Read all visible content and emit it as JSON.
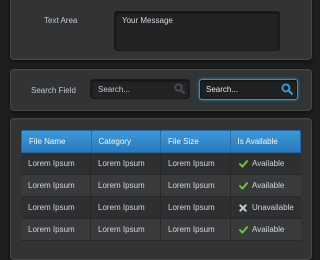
{
  "form": {
    "textarea_label": "Text Area",
    "textarea_value": "Your Message"
  },
  "search": {
    "label": "Search Field",
    "field1_placeholder": "Search...",
    "field2_placeholder": "Search..."
  },
  "table": {
    "headers": [
      "File Name",
      "Category",
      "File Size",
      "Is Available"
    ],
    "rows": [
      {
        "file_name": "Lorem Ipsum",
        "category": "Lorem Ipsum",
        "file_size": "Lorem Ipsum",
        "status": "Available",
        "status_icon": "check-icon"
      },
      {
        "file_name": "Lorem Ipsum",
        "category": "Lorem Ipsum",
        "file_size": "Lorem Ipsum",
        "status": "Available",
        "status_icon": "check-icon"
      },
      {
        "file_name": "Lorem Ipsum",
        "category": "Lorem Ipsum",
        "file_size": "Lorem Ipsum",
        "status": "Unavailable",
        "status_icon": "cross-icon"
      },
      {
        "file_name": "Lorem Ipsum",
        "category": "Lorem Ipsum",
        "file_size": "Lorem Ipsum",
        "status": "Available",
        "status_icon": "check-icon"
      }
    ]
  },
  "colors": {
    "accent": "#3d9ad9",
    "check": "#6fbf3a",
    "cross": "#c8cbce"
  }
}
